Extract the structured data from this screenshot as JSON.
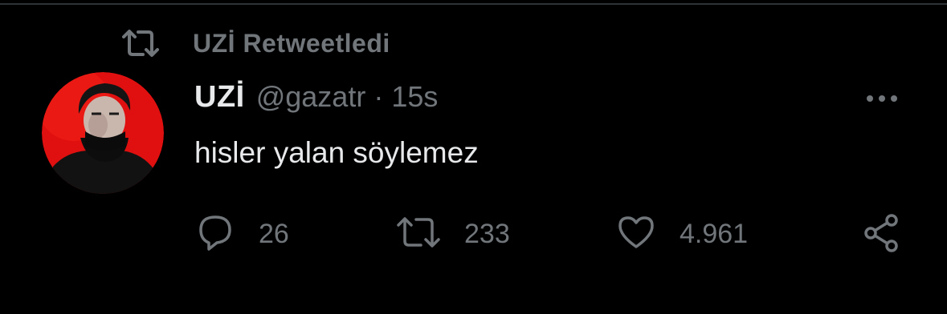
{
  "retweet_context": {
    "icon": "retweet-icon",
    "label": "UZİ Retweetledi"
  },
  "tweet": {
    "avatar": "avatar-image",
    "display_name": "UZİ",
    "handle": "@gazatr",
    "separator": "·",
    "time": "15s",
    "text": "hisler yalan söylemez",
    "more_icon": "more-options-icon"
  },
  "actions": {
    "reply": {
      "icon": "reply-icon",
      "count": "26"
    },
    "retweet": {
      "icon": "retweet-icon",
      "count": "233"
    },
    "like": {
      "icon": "heart-icon",
      "count": "4.961"
    },
    "share": {
      "icon": "share-icon"
    }
  },
  "colors": {
    "background": "#000000",
    "primary_text": "#e7e9ea",
    "secondary_text": "#71767b",
    "avatar_red": "#e01010"
  }
}
